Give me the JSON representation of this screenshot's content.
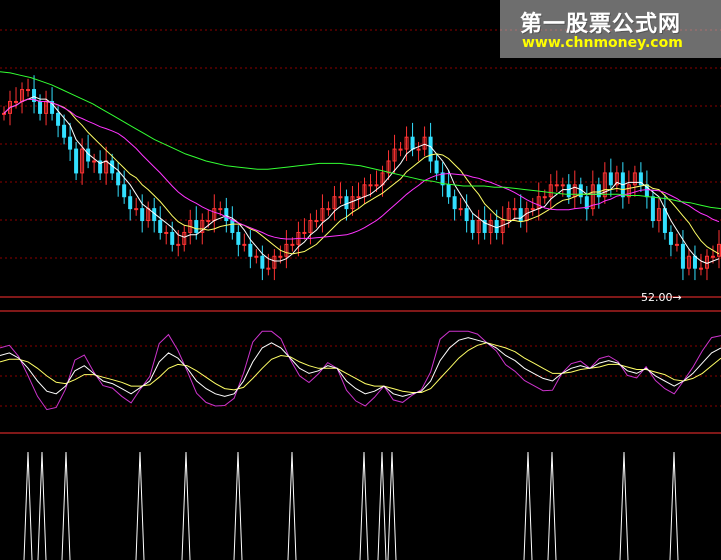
{
  "watermark": {
    "title": "第一股票公式网",
    "url": "www.chnmoney.com"
  },
  "low_label": "52.00",
  "colors": {
    "background": "#000000",
    "separator": "#ff3030",
    "grid": "#8b0000",
    "ma_short": "#ffffff",
    "ma_mid": "#ffff66",
    "ma_long": "#ff33ff",
    "ma_trend": "#33ff33",
    "up": "#ff3333",
    "down": "#33e0ff",
    "osc_fast": "#ffffff",
    "osc_slow": "#ffff66",
    "osc_raw": "#cc33cc",
    "signal": "#ffffff"
  },
  "chart_data": [
    {
      "type": "candlestick",
      "panel": "price",
      "x_count": 120,
      "close_series": [
        59,
        60,
        60,
        61,
        61,
        60,
        59,
        60,
        59,
        58,
        57,
        56,
        54,
        56,
        55,
        55,
        54,
        55,
        54,
        53,
        52,
        51,
        51,
        50,
        51,
        50,
        49,
        49,
        48,
        48,
        49,
        50,
        49,
        50,
        50,
        51,
        51,
        50,
        49,
        48,
        48,
        47,
        47,
        46,
        46,
        47,
        47,
        48,
        48,
        49,
        49,
        50,
        50,
        51,
        51,
        52,
        52,
        51,
        52,
        52,
        53,
        53,
        53,
        54,
        55,
        56,
        56,
        57,
        56,
        56,
        57,
        55,
        54,
        53,
        52,
        51,
        51,
        50,
        49,
        50,
        49,
        50,
        49,
        50,
        51,
        51,
        50,
        51,
        51,
        52,
        52,
        53,
        53,
        53,
        52,
        53,
        52,
        51,
        53,
        52,
        54,
        53,
        54,
        52,
        53,
        54,
        53,
        52,
        50,
        51,
        49,
        48,
        48,
        46,
        47,
        46,
        46,
        47,
        47,
        48
      ],
      "ma_trend": [
        62.5,
        62.4,
        62.2,
        62.0,
        61.7,
        61.4,
        61.0,
        60.6,
        60.2,
        59.8,
        59.3,
        58.8,
        58.3,
        57.8,
        57.3,
        56.8,
        56.4,
        56.0,
        55.6,
        55.3,
        55.0,
        54.8,
        54.6,
        54.5,
        54.4,
        54.3,
        54.3,
        54.4,
        54.5,
        54.6,
        54.7,
        54.8,
        54.8,
        54.8,
        54.7,
        54.6,
        54.4,
        54.2,
        54.0,
        53.8,
        53.6,
        53.4,
        53.3,
        53.1,
        53.0,
        52.9,
        52.9,
        52.9,
        52.8,
        52.8,
        52.7,
        52.6,
        52.5,
        52.4,
        52.3,
        52.2,
        52.2,
        52.2,
        52.2,
        52.2,
        52.2,
        52.1,
        52.1,
        52.0,
        51.9,
        51.8,
        51.6,
        51.5,
        51.3,
        51.1,
        51.0
      ]
    },
    {
      "type": "line",
      "panel": "oscillator",
      "k": [
        60,
        62,
        58,
        50,
        40,
        32,
        30,
        36,
        48,
        52,
        46,
        40,
        38,
        34,
        30,
        35,
        40,
        55,
        62,
        58,
        50,
        40,
        34,
        30,
        28,
        30,
        40,
        55,
        66,
        70,
        66,
        58,
        50,
        46,
        48,
        52,
        50,
        40,
        34,
        30,
        32,
        36,
        30,
        28,
        30,
        32,
        40,
        56,
        66,
        72,
        74,
        72,
        70,
        66,
        60,
        56,
        50,
        46,
        42,
        40,
        46,
        50,
        52,
        50,
        54,
        56,
        54,
        48,
        46,
        50,
        44,
        40,
        36,
        40,
        46,
        54,
        62,
        66
      ],
      "d": [
        55,
        57,
        57,
        55,
        50,
        44,
        39,
        38,
        41,
        45,
        45,
        43,
        41,
        39,
        36,
        36,
        37,
        43,
        50,
        53,
        52,
        48,
        43,
        38,
        34,
        33,
        35,
        42,
        50,
        57,
        60,
        59,
        55,
        52,
        50,
        50,
        50,
        46,
        42,
        38,
        36,
        36,
        34,
        32,
        31,
        31,
        34,
        42,
        50,
        58,
        64,
        68,
        70,
        68,
        66,
        63,
        58,
        54,
        50,
        46,
        46,
        47,
        49,
        50,
        51,
        53,
        53,
        51,
        49,
        49,
        47,
        45,
        41,
        40,
        42,
        46,
        52,
        58
      ]
    },
    {
      "type": "signal",
      "panel": "signal",
      "positions": [
        28,
        42,
        66,
        140,
        186,
        238,
        292,
        364,
        382,
        392,
        528,
        552,
        624,
        674
      ]
    }
  ]
}
